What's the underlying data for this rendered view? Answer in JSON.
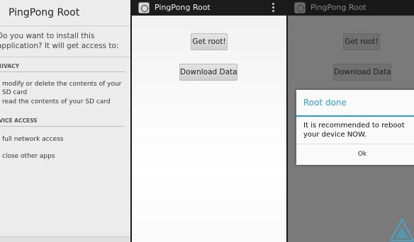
{
  "install_screen": {
    "title": "PingPong Root",
    "question": "Do you want to install this application? It will get access to:",
    "sections": [
      {
        "heading": "PRIVACY",
        "permissions": [
          "modify or delete the contents of your SD card",
          "read the contents of your SD card"
        ]
      },
      {
        "heading": "DEVICE ACCESS",
        "permissions": [
          "full network access",
          "close other apps"
        ]
      }
    ]
  },
  "app_screen": {
    "title": "PingPong Root",
    "get_root_label": "Get root!",
    "download_label": "Download Data",
    "app_icon": "pingpong-app-icon",
    "menu_icon": "overflow-menu-icon"
  },
  "dialog_screen": {
    "title": "PingPong Root",
    "get_root_label": "Get root!",
    "download_label": "Download Data",
    "dialog": {
      "title": "Root done",
      "message": "It is recommended to reboot your device NOW.",
      "ok_label": "Ok"
    },
    "watermark_icon": "triangle-logo-watermark"
  },
  "colors": {
    "accent": "#2a9fd6",
    "action_bar": "#1c1c1c",
    "dim_overlay": "#7a7a7a"
  }
}
